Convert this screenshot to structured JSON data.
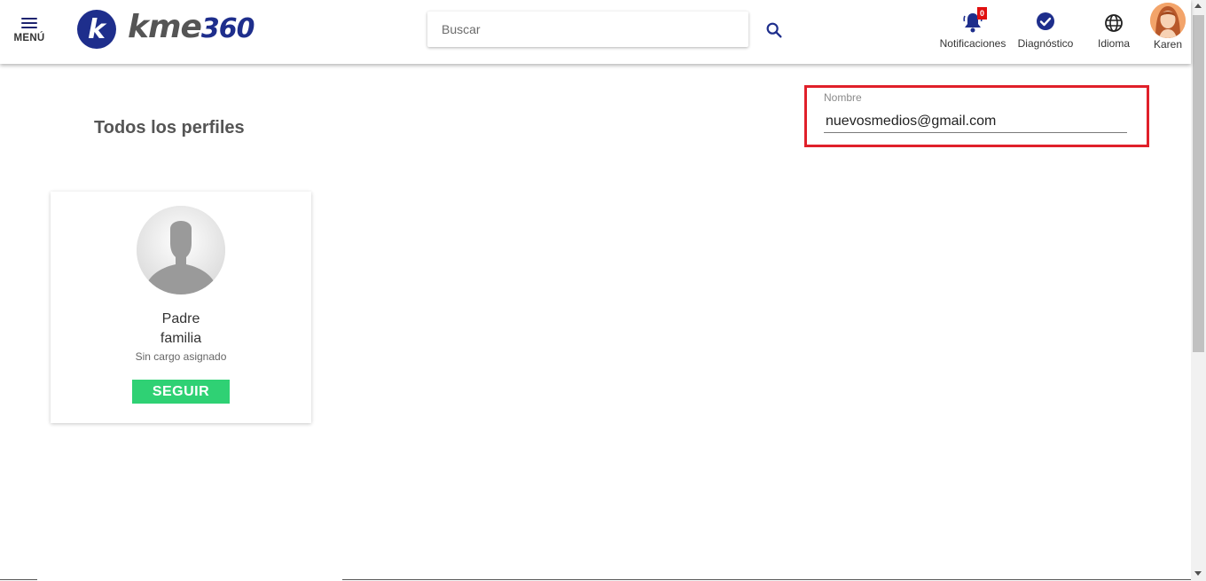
{
  "header": {
    "menu_label": "MENÚ",
    "logo": {
      "letter": "k",
      "text_kme": "kme",
      "text_360": "360"
    },
    "search": {
      "placeholder": "Buscar",
      "value": ""
    },
    "notifications": {
      "label": "Notificaciones",
      "count": "0"
    },
    "diagnostic": {
      "label": "Diagnóstico"
    },
    "language": {
      "label": "Idioma"
    },
    "user": {
      "name": "Karen"
    }
  },
  "main": {
    "title": "Todos los perfiles",
    "name_field": {
      "label": "Nombre",
      "value": "nuevosmedios@gmail.com"
    }
  },
  "profiles": [
    {
      "name_line1": "Padre",
      "name_line2": "familia",
      "position": "Sin cargo asignado",
      "follow_label": "SEGUIR"
    }
  ],
  "colors": {
    "brand": "#1e2e8c",
    "highlight": "#e0202a",
    "follow": "#2fd174",
    "badge": "#e01010"
  }
}
